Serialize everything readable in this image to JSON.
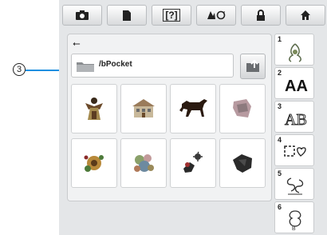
{
  "callout": {
    "number": "3"
  },
  "toolbar": {
    "buttons": [
      {
        "icon": "camera-icon"
      },
      {
        "icon": "document-icon"
      },
      {
        "icon": "help-icon",
        "label": "[?]"
      },
      {
        "icon": "settings-icon"
      },
      {
        "icon": "lock-icon"
      },
      {
        "icon": "home-icon"
      }
    ]
  },
  "browser": {
    "device_icon": "usb-icon",
    "path": "/bPocket",
    "folder_icon": "folder-icon",
    "up_button_icon": "folder-up-icon",
    "patterns": [
      {
        "name": "angel-pattern"
      },
      {
        "name": "house-pattern"
      },
      {
        "name": "horse-pattern"
      },
      {
        "name": "leaf-pattern"
      },
      {
        "name": "flower-pattern"
      },
      {
        "name": "floral-cluster-pattern"
      },
      {
        "name": "bird-flower-pattern"
      },
      {
        "name": "leaf-dark-pattern"
      }
    ]
  },
  "categories": [
    {
      "number": "1",
      "icon": "floral-motif-icon"
    },
    {
      "number": "2",
      "icon": "alphabet-icon",
      "label": "AA"
    },
    {
      "number": "3",
      "icon": "decorative-alphabet-icon",
      "label": "AB"
    },
    {
      "number": "4",
      "icon": "frame-shapes-icon"
    },
    {
      "number": "5",
      "icon": "scroll-motif-icon"
    },
    {
      "number": "6",
      "icon": "monogram-icon"
    }
  ],
  "colors": {
    "callout_line": "#1d8fe0",
    "screen_bg": "#e4e6e8"
  }
}
